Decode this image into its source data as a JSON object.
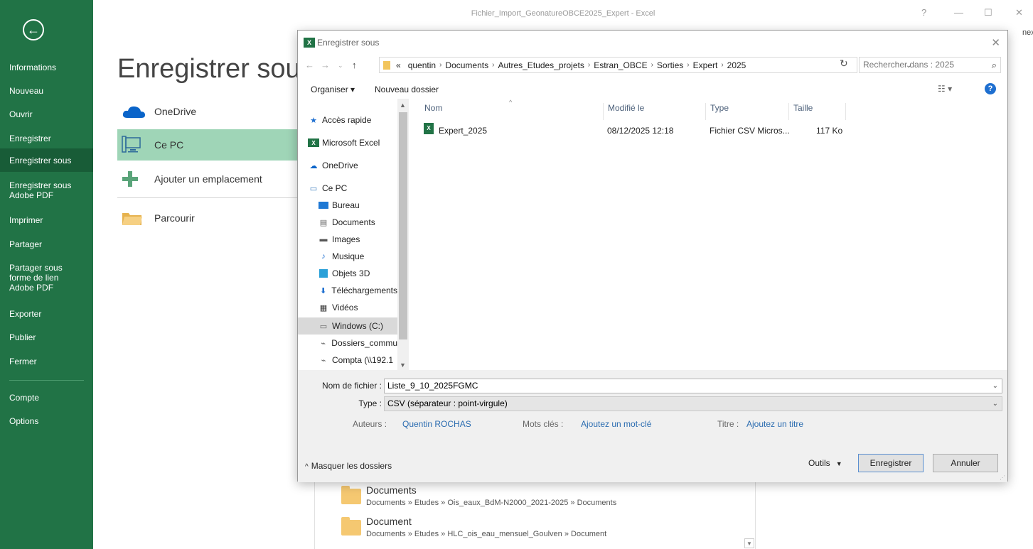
{
  "app": {
    "title": "Fichier_Import_GeonatureOBCE2025_Expert - Excel",
    "help": "?",
    "minimize": "—",
    "restore": "☐",
    "close": "✕",
    "connexion": "nexion"
  },
  "sidebar": {
    "back": "←",
    "items": [
      {
        "label": "Informations"
      },
      {
        "label": "Nouveau"
      },
      {
        "label": "Ouvrir"
      },
      {
        "label": "Enregistrer"
      },
      {
        "label": "Enregistrer sous"
      },
      {
        "label": "Enregistrer sous Adobe PDF"
      },
      {
        "label": "Imprimer"
      },
      {
        "label": "Partager"
      },
      {
        "label": "Partager sous forme de lien Adobe PDF"
      },
      {
        "label": "Exporter"
      },
      {
        "label": "Publier"
      },
      {
        "label": "Fermer"
      },
      {
        "label": "Compte"
      },
      {
        "label": "Options"
      }
    ]
  },
  "backstage": {
    "title": "Enregistrer sous",
    "locations": [
      {
        "label": "OneDrive",
        "icon": "cloud-icon"
      },
      {
        "label": "Ce PC",
        "icon": "computer-icon"
      },
      {
        "label": "Ajouter un emplacement",
        "icon": "plus-icon"
      },
      {
        "label": "Parcourir",
        "icon": "folder-icon"
      }
    ],
    "recent": [
      {
        "name": "Documents",
        "path": "Documents » Etudes » Ois_eaux_BdM-N2000_2021-2025 » Documents"
      },
      {
        "name": "Document",
        "path": "Documents » Etudes » HLC_ois_eau_mensuel_Goulven » Document"
      }
    ]
  },
  "dialog": {
    "title": "Enregistrer sous",
    "path_prefix": "«",
    "breadcrumbs": [
      "quentin",
      "Documents",
      "Autres_Etudes_projets",
      "Estran_OBCE",
      "Sorties",
      "Expert",
      "2025"
    ],
    "search_placeholder": "Rechercher dans : 2025",
    "toolbar": {
      "organiser": "Organiser ▾",
      "nouveau_dossier": "Nouveau dossier"
    },
    "nav": [
      {
        "label": "Accès rapide",
        "icon": "star-icon"
      },
      {
        "label": "Microsoft Excel",
        "icon": "excel-icon"
      },
      {
        "label": "OneDrive",
        "icon": "cloud-icon"
      },
      {
        "label": "Ce PC",
        "icon": "computer-icon"
      },
      {
        "label": "Bureau",
        "icon": "desktop-icon"
      },
      {
        "label": "Documents",
        "icon": "documents-icon"
      },
      {
        "label": "Images",
        "icon": "images-icon"
      },
      {
        "label": "Musique",
        "icon": "music-icon"
      },
      {
        "label": "Objets 3D",
        "icon": "cube-icon"
      },
      {
        "label": "Téléchargements",
        "icon": "download-icon"
      },
      {
        "label": "Vidéos",
        "icon": "video-icon"
      },
      {
        "label": "Windows (C:)",
        "icon": "drive-icon"
      },
      {
        "label": "Dossiers_commu",
        "icon": "network-drive-icon"
      },
      {
        "label": "Compta (\\\\192.1",
        "icon": "network-drive-icon"
      }
    ],
    "columns": [
      "Nom",
      "Modifié le",
      "Type",
      "Taille"
    ],
    "files": [
      {
        "name": "Expert_2025",
        "modified": "08/12/2025 12:18",
        "type": "Fichier CSV Micros...",
        "size": "117 Ko"
      }
    ],
    "form": {
      "filename_label": "Nom de fichier :",
      "filename": "Liste_9_10_2025FGMC",
      "type_label": "Type :",
      "type": "CSV (séparateur : point-virgule)",
      "authors_label": "Auteurs :",
      "authors": "Quentin ROCHAS",
      "keywords_label": "Mots clés :",
      "keywords": "Ajoutez un mot-clé",
      "title_label": "Titre :",
      "title_value": "Ajoutez un titre"
    },
    "hide_folders": "Masquer les dossiers",
    "tools": "Outils",
    "save": "Enregistrer",
    "cancel": "Annuler"
  }
}
